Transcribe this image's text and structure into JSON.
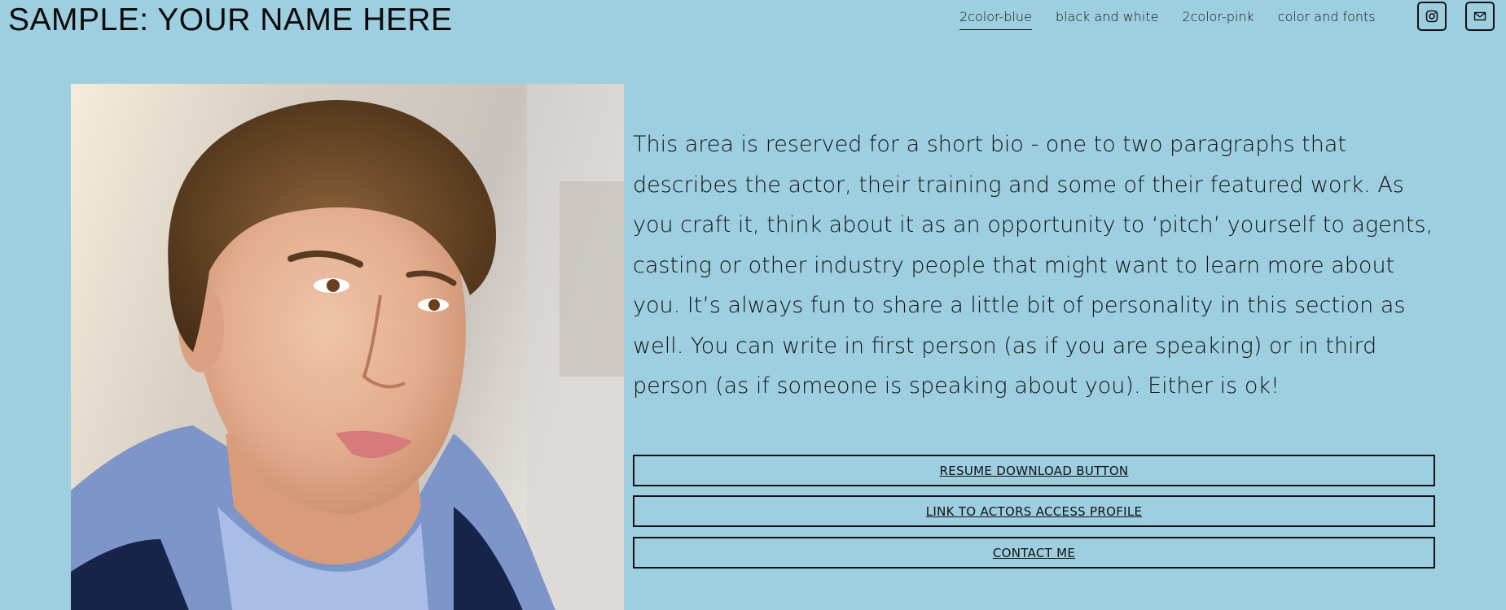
{
  "header": {
    "site_title": "SAMPLE: YOUR NAME HERE",
    "nav": [
      {
        "label": "2color-blue",
        "active": true
      },
      {
        "label": "black and white",
        "active": false
      },
      {
        "label": "2color-pink",
        "active": false
      },
      {
        "label": "color and fonts",
        "active": false
      }
    ],
    "social": [
      {
        "icon": "instagram-icon"
      },
      {
        "icon": "email-icon"
      }
    ]
  },
  "main": {
    "photo_icon": "headshot-photo",
    "bio": "This area is reserved for a short bio - one to two paragraphs that describes the actor, their training and some of their featured work. As you craft it, think about it as an opportunity to ‘pitch’ yourself to agents, casting or other industry people that might want to learn more about you.  It’s always fun to share a little bit of personality in this section as well.  You can write in first person (as if you are speaking) or in third person (as if someone is speaking about you). Either is ok!",
    "buttons": {
      "resume": "RESUME DOWNLOAD BUTTON",
      "actors_access": "LINK TO ACTORS ACCESS PROFILE",
      "contact": "CONTACT ME"
    }
  },
  "colors": {
    "background": "#9ecfe0",
    "text": "#111111"
  }
}
